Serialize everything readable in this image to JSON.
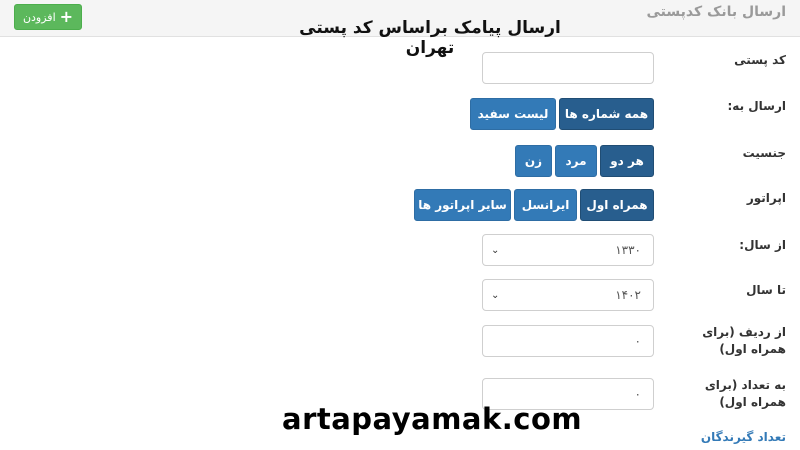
{
  "header": {
    "panel_title": "ارسال بانک کدپستی",
    "add_button_label": "افزودن",
    "overlay_title": "ارسال پیامک براساس کد پستی تهران"
  },
  "form": {
    "postal_code": {
      "label": "کد پستی",
      "value": ""
    },
    "send_to": {
      "label": "ارسال به:",
      "options": [
        "همه شماره ها",
        "لیست سفید"
      ]
    },
    "gender": {
      "label": "جنسیت",
      "options": [
        "هر دو",
        "مرد",
        "زن"
      ]
    },
    "operator": {
      "label": "اپراتور",
      "options": [
        "همراه اول",
        "ایرانسل",
        "سایر اپراتور ها"
      ]
    },
    "from_year": {
      "label": "از سال:",
      "value": "۱۳۳۰"
    },
    "to_year": {
      "label": "تا سال",
      "value": "۱۴۰۲"
    },
    "from_row": {
      "label": "از ردیف (برای همراه اول)",
      "value": "۰"
    },
    "count": {
      "label": "به تعداد (برای همراه اول)",
      "value": "۰"
    }
  },
  "footer": {
    "recipients_count_label": "تعداد گیرندگان",
    "watermark": "artapayamak.com"
  },
  "colors": {
    "primary_button": "#337ab7",
    "active_button": "#285e8e",
    "success_button": "#5cb85c",
    "link": "#337ab7"
  }
}
